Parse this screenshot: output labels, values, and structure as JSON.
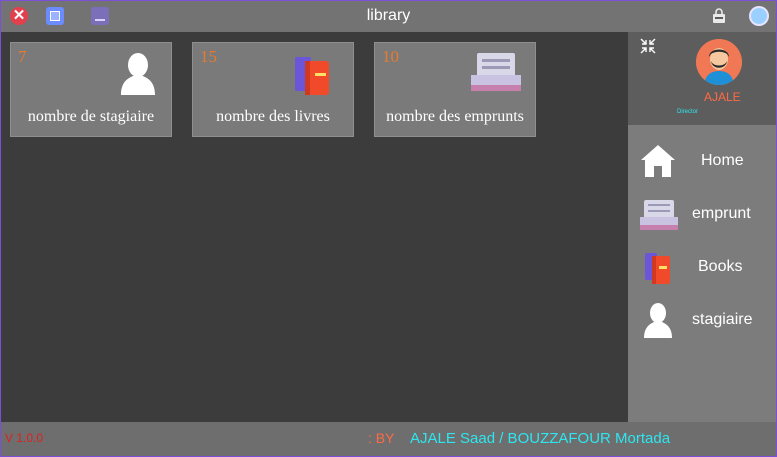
{
  "window": {
    "title": "library"
  },
  "titlebar": {
    "close_label": "✕"
  },
  "cards": [
    {
      "count": "7",
      "label": "nombre de stagiaire",
      "icon": "user-icon"
    },
    {
      "count": "15",
      "label": "nombre des livres",
      "icon": "books-icon"
    },
    {
      "count": "10",
      "label": "nombre des emprunts",
      "icon": "inbox-tray-icon"
    }
  ],
  "profile": {
    "name": "AJALE",
    "role": "Director"
  },
  "nav": [
    {
      "label": "Home",
      "icon": "home-icon"
    },
    {
      "label": "emprunt",
      "icon": "inbox-tray-icon"
    },
    {
      "label": "Books",
      "icon": "books-icon"
    },
    {
      "label": "stagiaire",
      "icon": "user-icon"
    }
  ],
  "footer": {
    "version": "V 1.0.0",
    "by": ": BY",
    "authors": "AJALE  Saad / BOUZZAFOUR Mortada"
  },
  "colors": {
    "accent_orange": "#e87a2c",
    "accent_cyan": "#2ee6f0",
    "border_purple": "#7b4fd8"
  }
}
